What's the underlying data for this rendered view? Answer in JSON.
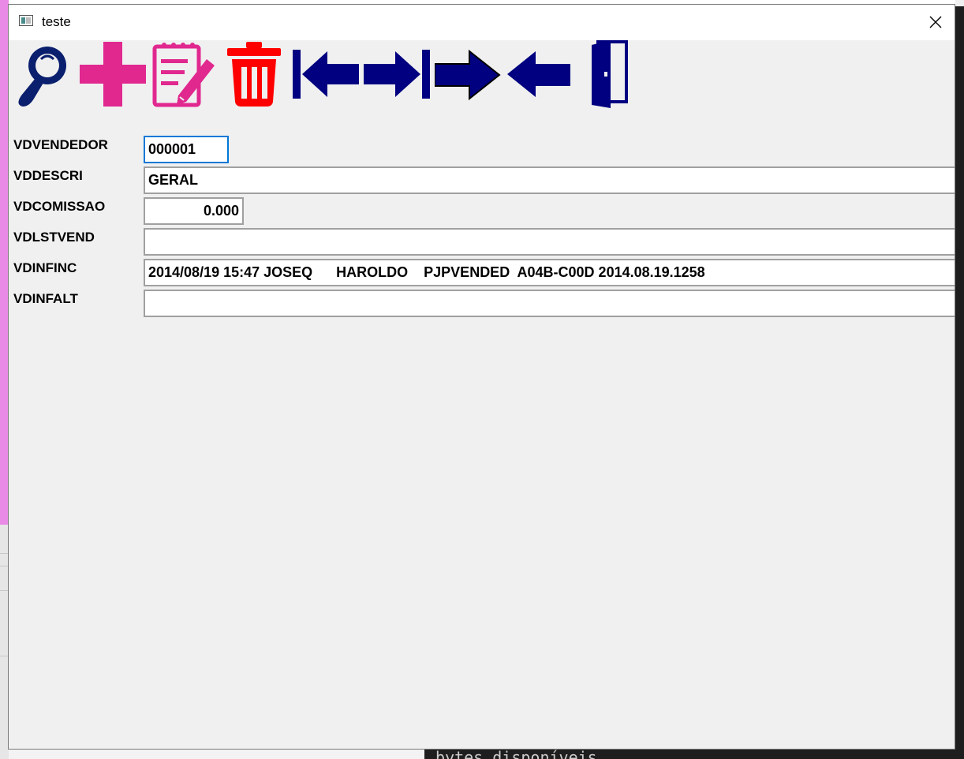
{
  "window": {
    "title": "teste"
  },
  "toolbar": {
    "buttons": [
      {
        "name": "search",
        "icon": "magnifier-icon",
        "color": "#0a1f6e"
      },
      {
        "name": "add",
        "icon": "plus-icon",
        "color": "#e0288f"
      },
      {
        "name": "edit",
        "icon": "notepad-edit-icon",
        "color": "#e0288f"
      },
      {
        "name": "delete",
        "icon": "trash-icon",
        "color": "#ff0000"
      },
      {
        "name": "first",
        "icon": "arrow-first-icon",
        "color": "#000080"
      },
      {
        "name": "last",
        "icon": "arrow-last-icon",
        "color": "#000080"
      },
      {
        "name": "next",
        "icon": "arrow-right-icon",
        "color": "#000080"
      },
      {
        "name": "previous",
        "icon": "arrow-left-icon",
        "color": "#000080"
      },
      {
        "name": "exit",
        "icon": "door-exit-icon",
        "color": "#000080"
      }
    ]
  },
  "form": {
    "fields": [
      {
        "label": "VDVENDEDOR",
        "value": "000001"
      },
      {
        "label": "VDDESCRI",
        "value": "GERAL"
      },
      {
        "label": "VDCOMISSAO",
        "value": "0.000"
      },
      {
        "label": "VDLSTVEND",
        "value": ""
      },
      {
        "label": "VDINFINC",
        "value": "2014/08/19 15:47 JOSEQ      HAROLDO    PJPVENDED  A04B-C00D 2014.08.19.1258"
      },
      {
        "label": "VDINFALT",
        "value": ""
      }
    ]
  },
  "background": {
    "terminal_text": "bytes disponíveis"
  }
}
